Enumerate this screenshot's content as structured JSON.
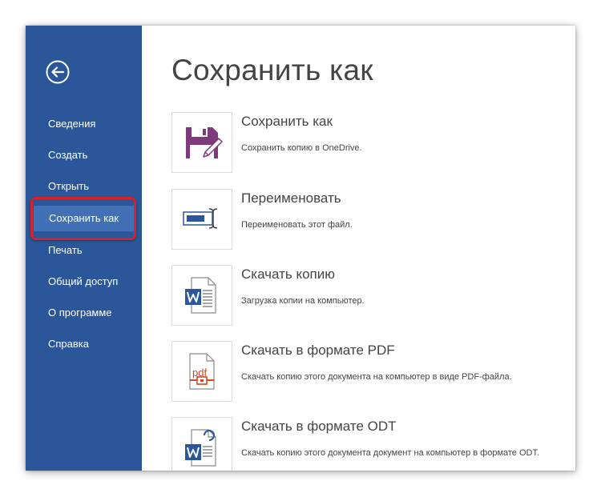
{
  "sidebar": {
    "items": [
      {
        "label": "Сведения"
      },
      {
        "label": "Создать"
      },
      {
        "label": "Открыть"
      },
      {
        "label": "Сохранить как",
        "active": true
      },
      {
        "label": "Печать"
      },
      {
        "label": "Общий доступ"
      },
      {
        "label": "О программе"
      },
      {
        "label": "Справка"
      }
    ]
  },
  "main": {
    "title": "Сохранить как",
    "options": [
      {
        "title": "Сохранить как",
        "desc": "Сохранить копию в OneDrive.",
        "icon": "save-as-floppy-icon"
      },
      {
        "title": "Переименовать",
        "desc": "Переименовать этот файл.",
        "icon": "rename-icon"
      },
      {
        "title": "Скачать копию",
        "desc": "Загрузка копии на компьютер.",
        "icon": "word-document-icon"
      },
      {
        "title": "Скачать в формате PDF",
        "desc": "Скачать копию этого документа на компьютер в виде PDF-файла.",
        "icon": "pdf-document-icon",
        "icon_label": "pdf"
      },
      {
        "title": "Скачать в формате ODT",
        "desc": "Скачать копию этого документа документ на компьютер в формате ODT.",
        "icon": "word-odt-document-icon"
      }
    ]
  },
  "colors": {
    "sidebar_bg": "#2b579a",
    "active_item_bg": "#4170b5",
    "highlight_border": "#d8202a",
    "save_icon_purple": "#80397b",
    "word_blue": "#2b579a",
    "pdf_red": "#d24726"
  }
}
